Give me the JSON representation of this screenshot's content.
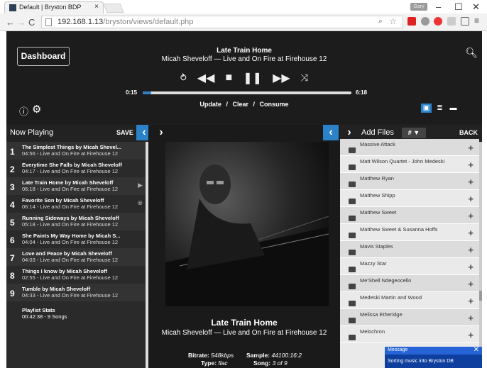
{
  "browser": {
    "tab_title": "Default | Bryston BDP",
    "tab_close": "×",
    "window_badge": "Gary",
    "url_host": "192.168.1.13",
    "url_path": "/bryston/views/default.php"
  },
  "header": {
    "dashboard_label": "Dashboard",
    "track_title": "Late Train Home",
    "track_subtitle": "Micah Sheveloff — Live and On Fire at Firehouse 12",
    "time_elapsed": "0:15",
    "time_total": "6:18",
    "progress_fraction": 0.04,
    "queue_update": "Update",
    "queue_clear": "Clear",
    "queue_consume": "Consume",
    "sep": "/"
  },
  "left_panel": {
    "title": "Now Playing",
    "save_label": "SAVE",
    "items": [
      {
        "num": "1",
        "title": "The Simplest Things by Micah Shevel...",
        "info": "04:56 - Live and On Fire at Firehouse 12",
        "icon": ""
      },
      {
        "num": "2",
        "title": "Everytime She Falls by Micah Sheveloff",
        "info": "04:17 - Live and On Fire at Firehouse 12",
        "icon": ""
      },
      {
        "num": "3",
        "title": "Late Train Home by Micah Sheveloff",
        "info": "06:18 - Live and On Fire at Firehouse 12",
        "icon": "▶"
      },
      {
        "num": "4",
        "title": "Favorite Son by Micah Sheveloff",
        "info": "06:14 - Live and On Fire at Firehouse 12",
        "icon": "⊗"
      },
      {
        "num": "5",
        "title": "Running Sideways by Micah Sheveloff",
        "info": "05:18 - Live and On Fire at Firehouse 12",
        "icon": ""
      },
      {
        "num": "6",
        "title": "She Paints My Way Home by Micah S...",
        "info": "04:04 - Live and On Fire at Firehouse 12",
        "icon": ""
      },
      {
        "num": "7",
        "title": "Love and Peace by Micah Sheveloff",
        "info": "04:03 - Live and On Fire at Firehouse 12",
        "icon": ""
      },
      {
        "num": "8",
        "title": "Things I know by Micah Sheveloff",
        "info": "02:55 - Live and On Fire at Firehouse 12",
        "icon": ""
      },
      {
        "num": "9",
        "title": "Tumble by Micah Sheveloff",
        "info": "04:33 - Live and On Fire at Firehouse 12",
        "icon": ""
      }
    ],
    "stats_title": "Playlist Stats",
    "stats_value": "00:42:38 - 9 Songs"
  },
  "center": {
    "album_title": "Late Train Home",
    "album_subtitle": "Micah Sheveloff — Live and On Fire at Firehouse 12",
    "bitrate_label": "Bitrate:",
    "bitrate_value": "548kbps",
    "sample_label": "Sample:",
    "sample_value": "44100:16:2",
    "type_label": "Type:",
    "type_value": "flac",
    "song_label": "Song:",
    "song_value": "3 of 9"
  },
  "right_panel": {
    "title": "Add Files",
    "sort_label": "#",
    "back_label": "BACK",
    "items": [
      "Massive Attack",
      "Matt Wilson Quartet - John Medeski",
      "Matthew Ryan",
      "Matthew Shipp",
      "Matthew Sweet",
      "Matthew Sweet & Susanna Hoffs",
      "Mavis Staples",
      "Mazzy Star",
      "Me'Shell Ndegeocello",
      "Medeski Martin and Wood",
      "Melissa Etheridge",
      "Melochron"
    ]
  },
  "toast": {
    "title": "Message",
    "message": "Sorting music into Bryston DB"
  },
  "colors": {
    "accent": "#2c82c9",
    "app_bg": "#1f1f1f",
    "browser_panel_bg": "#eaeaea"
  }
}
